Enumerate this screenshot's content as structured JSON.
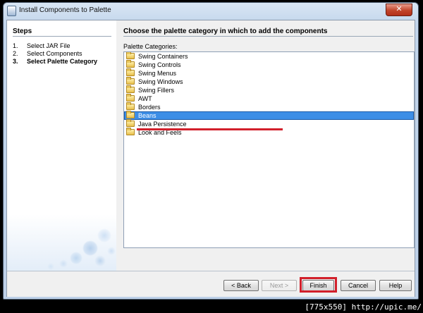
{
  "window": {
    "title": "Install Components to Palette",
    "close_label": "✕"
  },
  "steps": {
    "title": "Steps",
    "items": [
      {
        "num": "1.",
        "label": "Select JAR File",
        "current": false
      },
      {
        "num": "2.",
        "label": "Select Components",
        "current": false
      },
      {
        "num": "3.",
        "label": "Select Palette Category",
        "current": true
      }
    ]
  },
  "content": {
    "heading": "Choose the palette category in which to add the components",
    "list_label": "Palette Categories:",
    "categories": [
      "Swing Containers",
      "Swing Controls",
      "Swing Menus",
      "Swing Windows",
      "Swing Fillers",
      "AWT",
      "Borders",
      "Beans",
      "Java Persistence",
      "Look and Feels"
    ],
    "selected_category": "Beans"
  },
  "footer": {
    "back_label": "< Back",
    "next_label": "Next >",
    "finish_label": "Finish",
    "cancel_label": "Cancel",
    "help_label": "Help"
  },
  "watermark": "[775x550] http://upic.me/",
  "colors": {
    "selection": "#3d8ee6",
    "highlight_red": "#d2202b"
  },
  "icons": [
    "window-icon",
    "close-icon",
    "folder-icon"
  ]
}
